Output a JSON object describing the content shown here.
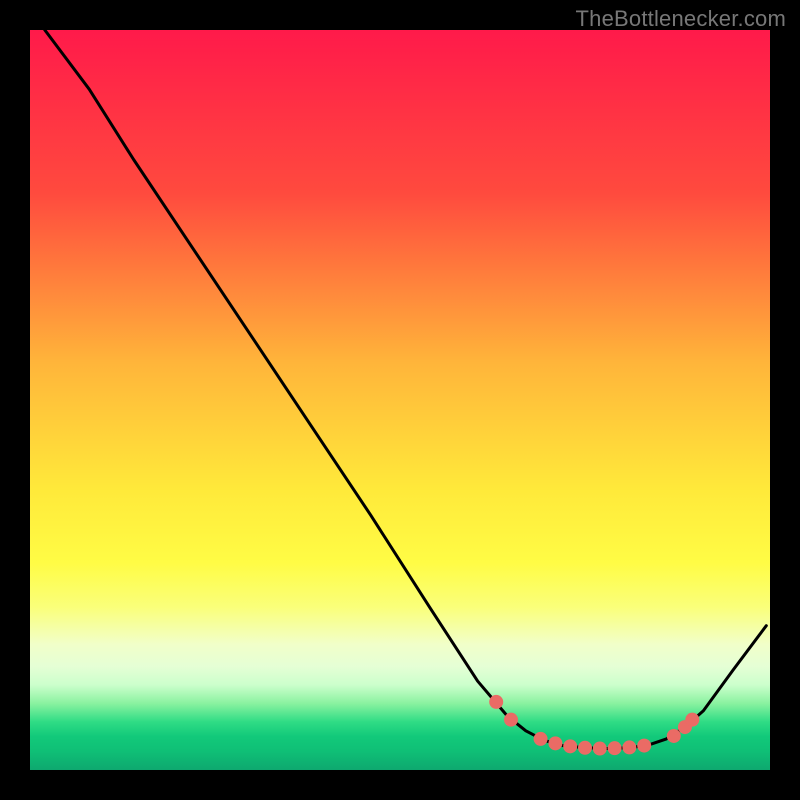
{
  "attribution": "TheBottlenecker.com",
  "chart_data": {
    "type": "line",
    "title": "",
    "xlabel": "",
    "ylabel": "",
    "xlim": [
      0,
      100
    ],
    "ylim": [
      0,
      100
    ],
    "colors": {
      "top": "#ff1a4a",
      "mid_upper": "#ff8c2e",
      "mid": "#fff23c",
      "lower": "#f3ff6a",
      "band_pale": "#f1ffc9",
      "bottom": "#17d77a",
      "curve": "#000000",
      "marker": "#ea6b65"
    },
    "gradient_stops": [
      {
        "offset": 0.0,
        "color": "#ff1a4a"
      },
      {
        "offset": 0.22,
        "color": "#ff4a3e"
      },
      {
        "offset": 0.45,
        "color": "#ffb53a"
      },
      {
        "offset": 0.62,
        "color": "#ffe93a"
      },
      {
        "offset": 0.72,
        "color": "#fffc45"
      },
      {
        "offset": 0.78,
        "color": "#faff7a"
      },
      {
        "offset": 0.83,
        "color": "#f1ffc9"
      },
      {
        "offset": 0.86,
        "color": "#e5ffd5"
      },
      {
        "offset": 0.885,
        "color": "#ccffcc"
      },
      {
        "offset": 0.91,
        "color": "#8af2a0"
      },
      {
        "offset": 0.935,
        "color": "#2fdc85"
      },
      {
        "offset": 0.955,
        "color": "#12c97a"
      },
      {
        "offset": 0.975,
        "color": "#0fbf76"
      },
      {
        "offset": 1.0,
        "color": "#0ea86f"
      }
    ],
    "curve": [
      {
        "x": 2.0,
        "y": 100.0
      },
      {
        "x": 8.0,
        "y": 92.0
      },
      {
        "x": 14.0,
        "y": 82.5
      },
      {
        "x": 22.0,
        "y": 70.5
      },
      {
        "x": 30.0,
        "y": 58.5
      },
      {
        "x": 38.0,
        "y": 46.5
      },
      {
        "x": 46.0,
        "y": 34.5
      },
      {
        "x": 54.0,
        "y": 22.0
      },
      {
        "x": 60.5,
        "y": 12.0
      },
      {
        "x": 64.5,
        "y": 7.3
      },
      {
        "x": 67.0,
        "y": 5.3
      },
      {
        "x": 69.5,
        "y": 4.0
      },
      {
        "x": 72.0,
        "y": 3.3
      },
      {
        "x": 75.0,
        "y": 3.0
      },
      {
        "x": 78.0,
        "y": 2.9
      },
      {
        "x": 81.0,
        "y": 3.0
      },
      {
        "x": 83.5,
        "y": 3.35
      },
      {
        "x": 86.0,
        "y": 4.2
      },
      {
        "x": 88.5,
        "y": 5.8
      },
      {
        "x": 91.0,
        "y": 8.0
      },
      {
        "x": 95.0,
        "y": 13.5
      },
      {
        "x": 99.5,
        "y": 19.5
      }
    ],
    "markers": [
      {
        "x": 63.0,
        "y": 9.2
      },
      {
        "x": 65.0,
        "y": 6.8
      },
      {
        "x": 69.0,
        "y": 4.2
      },
      {
        "x": 71.0,
        "y": 3.6
      },
      {
        "x": 73.0,
        "y": 3.2
      },
      {
        "x": 75.0,
        "y": 3.0
      },
      {
        "x": 77.0,
        "y": 2.9
      },
      {
        "x": 79.0,
        "y": 2.95
      },
      {
        "x": 81.0,
        "y": 3.05
      },
      {
        "x": 83.0,
        "y": 3.3
      },
      {
        "x": 87.0,
        "y": 4.6
      },
      {
        "x": 88.5,
        "y": 5.8
      },
      {
        "x": 89.5,
        "y": 6.8
      }
    ]
  }
}
